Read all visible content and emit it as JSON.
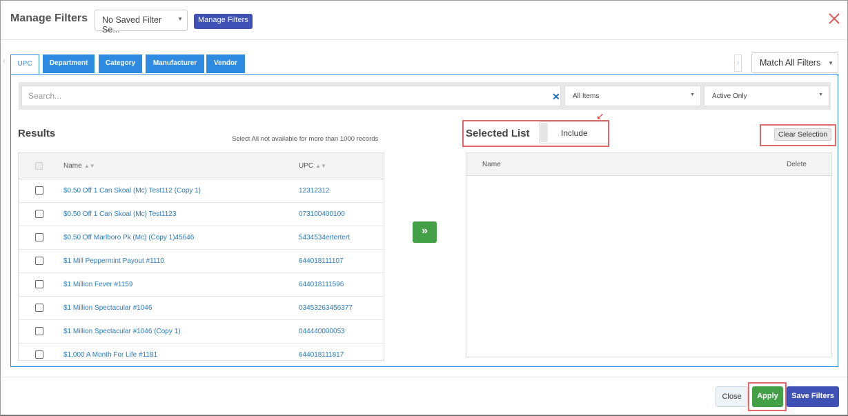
{
  "header": {
    "title": "Manage Filters",
    "saved_filter": "No Saved Filter Se...",
    "manage_button": "Manage Filters"
  },
  "tabs": [
    {
      "label": "UPC",
      "active": true
    },
    {
      "label": "Department",
      "active": false
    },
    {
      "label": "Category",
      "active": false
    },
    {
      "label": "Manufacturer",
      "active": false
    },
    {
      "label": "Vendor",
      "active": false
    }
  ],
  "match_select": "Match All Filters",
  "filters": {
    "search_placeholder": "Search...",
    "items_select": "All Items",
    "status_select": "Active Only"
  },
  "results": {
    "title": "Results",
    "note": "Select All not available for more than 1000 records",
    "col_name": "Name",
    "col_upc": "UPC",
    "rows": [
      {
        "name": "$0.50 Off 1 Can Skoal (Mc) Test112 (Copy 1)",
        "upc": "12312312"
      },
      {
        "name": "$0.50 Off 1 Can Skoal (Mc) Test1123",
        "upc": "073100400100"
      },
      {
        "name": "$0.50 Off Marlboro Pk (Mc) (Copy 1)45646",
        "upc": "5434534ertertert"
      },
      {
        "name": "$1 Mill Peppermint Payout #1110",
        "upc": "644018111107"
      },
      {
        "name": "$1 Million Fever #1159",
        "upc": "644018111596"
      },
      {
        "name": "$1 Million Spectacular #1046",
        "upc": "03453263456377"
      },
      {
        "name": "$1 Million Spectacular #1046 (Copy 1)",
        "upc": "044440000053"
      },
      {
        "name": "$1,000 A Month For Life #1181",
        "upc": "644018111817"
      }
    ]
  },
  "selected": {
    "title": "Selected List",
    "toggle_label": "Include",
    "clear_button": "Clear Selection",
    "col_name": "Name",
    "col_delete": "Delete"
  },
  "footer": {
    "close": "Close",
    "apply": "Apply",
    "save": "Save Filters"
  },
  "colors": {
    "primary_blue": "#2f8ae2",
    "indigo": "#3f51b5",
    "green": "#43a047",
    "highlight_red": "#e06a6a"
  }
}
